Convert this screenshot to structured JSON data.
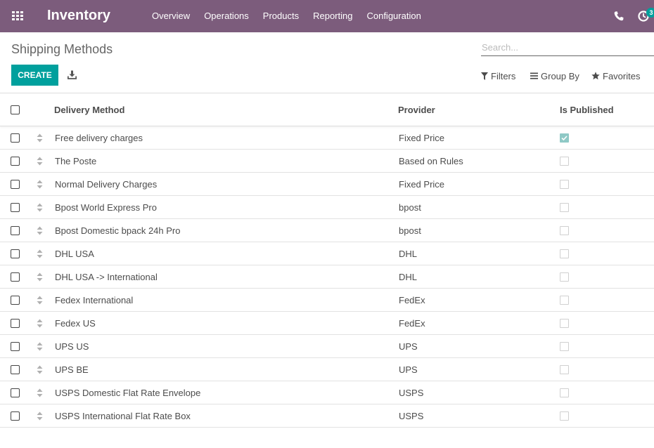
{
  "navbar": {
    "app_name": "Inventory",
    "menu": [
      "Overview",
      "Operations",
      "Products",
      "Reporting",
      "Configuration"
    ],
    "activity_count": "3",
    "icons": [
      "apps-grid-icon",
      "phone-icon",
      "activity-clock-icon"
    ]
  },
  "control_panel": {
    "breadcrumb": "Shipping Methods",
    "search_placeholder": "Search...",
    "create_label": "CREATE",
    "filters_label": "Filters",
    "group_by_label": "Group By",
    "favorites_label": "Favorites"
  },
  "table": {
    "columns": [
      "Delivery Method",
      "Provider",
      "Is Published"
    ],
    "rows": [
      {
        "name": "Free delivery charges",
        "provider": "Fixed Price",
        "published": true
      },
      {
        "name": "The Poste",
        "provider": "Based on Rules",
        "published": false
      },
      {
        "name": "Normal Delivery Charges",
        "provider": "Fixed Price",
        "published": false
      },
      {
        "name": "Bpost World Express Pro",
        "provider": "bpost",
        "published": false
      },
      {
        "name": "Bpost Domestic bpack 24h Pro",
        "provider": "bpost",
        "published": false
      },
      {
        "name": "DHL USA",
        "provider": "DHL",
        "published": false
      },
      {
        "name": "DHL USA -> International",
        "provider": "DHL",
        "published": false
      },
      {
        "name": "Fedex International",
        "provider": "FedEx",
        "published": false
      },
      {
        "name": "Fedex US",
        "provider": "FedEx",
        "published": false
      },
      {
        "name": "UPS US",
        "provider": "UPS",
        "published": false
      },
      {
        "name": "UPS BE",
        "provider": "UPS",
        "published": false
      },
      {
        "name": "USPS Domestic Flat Rate Envelope",
        "provider": "USPS",
        "published": false
      },
      {
        "name": "USPS International Flat Rate Box",
        "provider": "USPS",
        "published": false
      }
    ]
  },
  "colors": {
    "navbar": "#7c5c7c",
    "primary": "#00a09d",
    "published_check": "#8fc9c6"
  }
}
